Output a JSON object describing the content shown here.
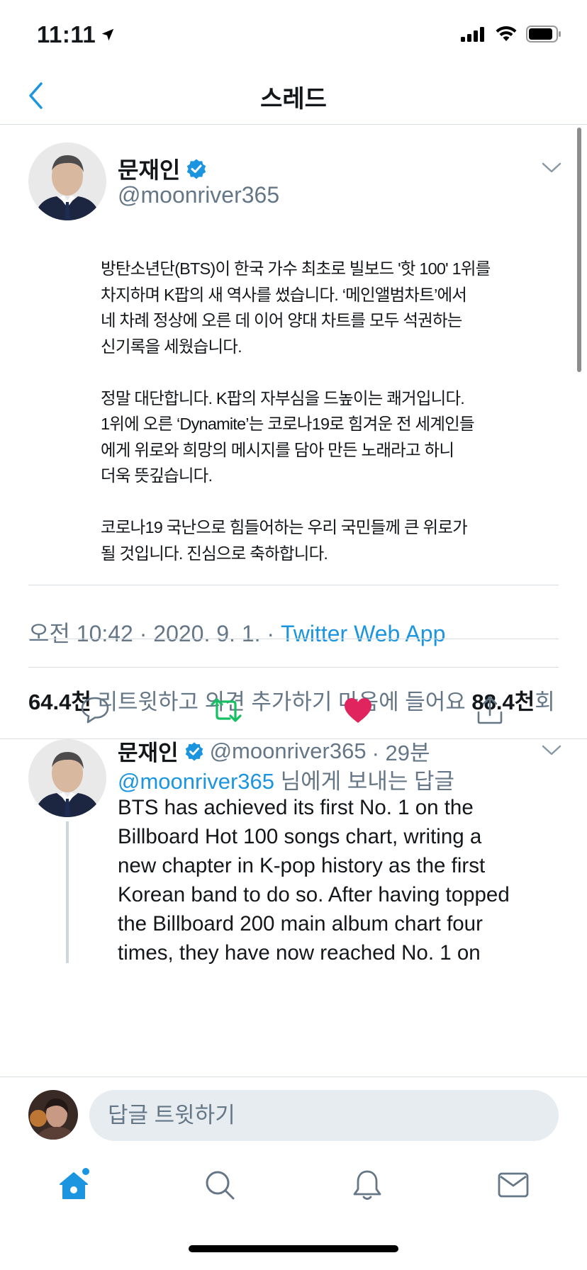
{
  "status_bar": {
    "time": "11:11"
  },
  "nav": {
    "title": "스레드"
  },
  "main_tweet": {
    "author_name": "문재인",
    "handle": "@moonriver365",
    "body": [
      [
        "방탄소년단(BTS)이 한국 가수 최초로 빌보드 '핫 100' 1위를",
        "차지하며 K팝의 새 역사를 썼습니다. ‘메인앨범차트’에서",
        "네 차례 정상에 오른 데 이어 양대 차트를 모두 석권하는",
        "신기록을 세웠습니다."
      ],
      [
        "정말 대단합니다. K팝의 자부심을 드높이는 쾌거입니다.",
        "1위에 오른 ‘Dynamite’는 코로나19로 힘겨운 전 세계인들",
        "에게 위로와 희망의 메시지를 담아 만든 노래라고 하니",
        "더욱 뜻깊습니다."
      ],
      [
        "코로나19  국난으로 힘들어하는 우리 국민들께 큰 위로가",
        "될 것입니다. 진심으로 축하합니다."
      ]
    ],
    "timestamp": "오전 10:42 · 2020. 9. 1. · ",
    "source": "Twitter Web App",
    "retweet_count": "64.4천",
    "retweet_label": " 리트윗하고 의견 추가하기  마음에 들어요 ",
    "like_count": "88.4천",
    "like_suffix": "회"
  },
  "reply_tweet": {
    "author_name": "문재인",
    "handle": "@moonriver365",
    "time_ago": "· 29분",
    "reply_to_mention": "@moonriver365",
    "reply_to_suffix": " 님에게 보내는 답글",
    "body_lines": [
      "BTS has achieved its first No. 1 on the",
      "Billboard Hot 100 songs chart, writing a",
      "new chapter in K-pop history as the first",
      "Korean band to do so. After having topped",
      "the Billboard 200 main album chart four",
      "times, they have now reached No. 1 on"
    ]
  },
  "compose": {
    "placeholder": "답글 트윗하기"
  },
  "colors": {
    "accent": "#1b95e0",
    "retweet_green": "#17bf63",
    "like_red": "#e0245e",
    "muted": "#657786"
  },
  "icons": {
    "tabs": [
      "home-icon",
      "search-icon",
      "notifications-icon",
      "messages-icon"
    ],
    "actions": [
      "reply-icon",
      "retweet-icon",
      "like-icon",
      "share-icon"
    ]
  }
}
